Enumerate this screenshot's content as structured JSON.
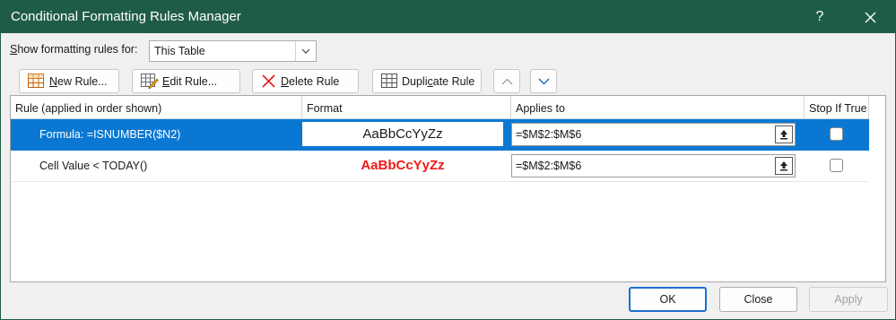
{
  "window": {
    "title": "Conditional Formatting Rules Manager",
    "help_glyph": "?"
  },
  "scope": {
    "label_accel": "S",
    "label_rest": "how formatting rules for:",
    "value": "This Table"
  },
  "toolbar": {
    "new_accel": "N",
    "new_rest": "ew Rule...",
    "edit_accel": "E",
    "edit_rest": "dit Rule...",
    "delete_accel": "D",
    "delete_rest": "elete Rule",
    "duplicate_pre": "Dupli",
    "duplicate_accel": "c",
    "duplicate_post": "ate Rule"
  },
  "columns": {
    "rule": "Rule (applied in order shown)",
    "format": "Format",
    "applies": "Applies to",
    "stop": "Stop If True"
  },
  "rules": [
    {
      "rule": "Formula: =ISNUMBER($N2)",
      "format_preview": "AaBbCcYyZz",
      "applies_to": "=$M$2:$M$6",
      "stop_if_true": false,
      "selected": true
    },
    {
      "rule": "Cell Value < TODAY()",
      "format_preview": "AaBbCcYyZz",
      "applies_to": "=$M$2:$M$6",
      "stop_if_true": false,
      "selected": false
    }
  ],
  "footer": {
    "ok": "OK",
    "close": "Close",
    "apply": "Apply"
  },
  "colors": {
    "titlebar": "#1f5c46",
    "selection": "#0a78d2",
    "preview_red": "#f01818",
    "delete_icon": "#e02020"
  }
}
